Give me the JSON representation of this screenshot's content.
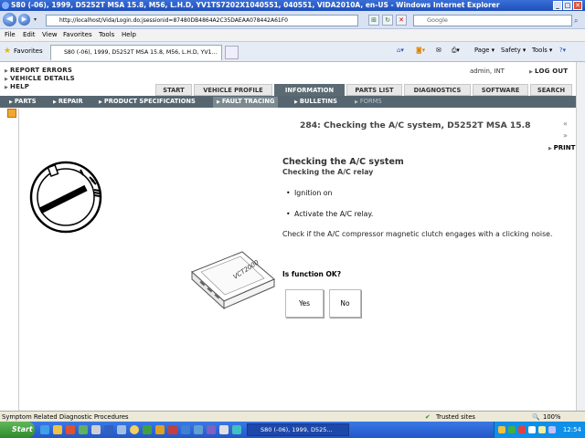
{
  "window": {
    "title": "S80 (-06), 1999, D5252T MSA 15.8, M56, L.H.D, YV1TS7202X1040551, 040551, VIDA2010A, en-US - Windows Internet Explorer",
    "minimize": "_",
    "maximize": "□",
    "close": "✕"
  },
  "browser": {
    "url": "http://localhost/Vida/Login.do;jsessionid=87480DB4864A2C35DAEAA078442A61F0",
    "search_placeholder": "Google",
    "menu": [
      "File",
      "Edit",
      "View",
      "Favorites",
      "Tools",
      "Help"
    ],
    "favorites_label": "Favorites",
    "tab_title": "S80 (-06), 1999, D5252T MSA 15.8, M56, L.H.D, YV1...",
    "toolbar": {
      "page": "Page ▾",
      "safety": "Safety ▾",
      "tools": "Tools ▾",
      "help": "?▾"
    }
  },
  "app": {
    "left_links": [
      "REPORT ERRORS",
      "VEHICLE DETAILS",
      "HELP"
    ],
    "user": "admin, INT",
    "logout": "LOG OUT",
    "tabs": [
      "START",
      "VEHICLE PROFILE",
      "INFORMATION",
      "PARTS LIST",
      "DIAGNOSTICS",
      "SOFTWARE",
      "SEARCH"
    ],
    "active_tab": "INFORMATION",
    "subnav": [
      "PARTS",
      "REPAIR",
      "PRODUCT SPECIFICATIONS",
      "FAULT TRACING",
      "BULLETINS",
      "FORMS"
    ],
    "active_subnav": "FAULT TRACING"
  },
  "document": {
    "title": "284: Checking the A/C system, D5252T MSA 15.8",
    "print": "PRINT",
    "heading": "Checking the A/C system",
    "subheading": "Checking the A/C relay",
    "bullets": [
      "Ignition on",
      "Activate the A/C relay."
    ],
    "paragraph": "Check if the A/C compressor magnetic clutch engages with a clicking noise.",
    "question": "Is function OK?",
    "yes": "Yes",
    "no": "No",
    "device_label": "VCT2000"
  },
  "status": {
    "text": "Symptom Related Diagnostic Procedures",
    "zone": "Trusted sites",
    "zoom": "100%"
  },
  "taskbar": {
    "start": "Start",
    "task": "S80 (-06), 1999, D525...",
    "clock": "12:54"
  }
}
